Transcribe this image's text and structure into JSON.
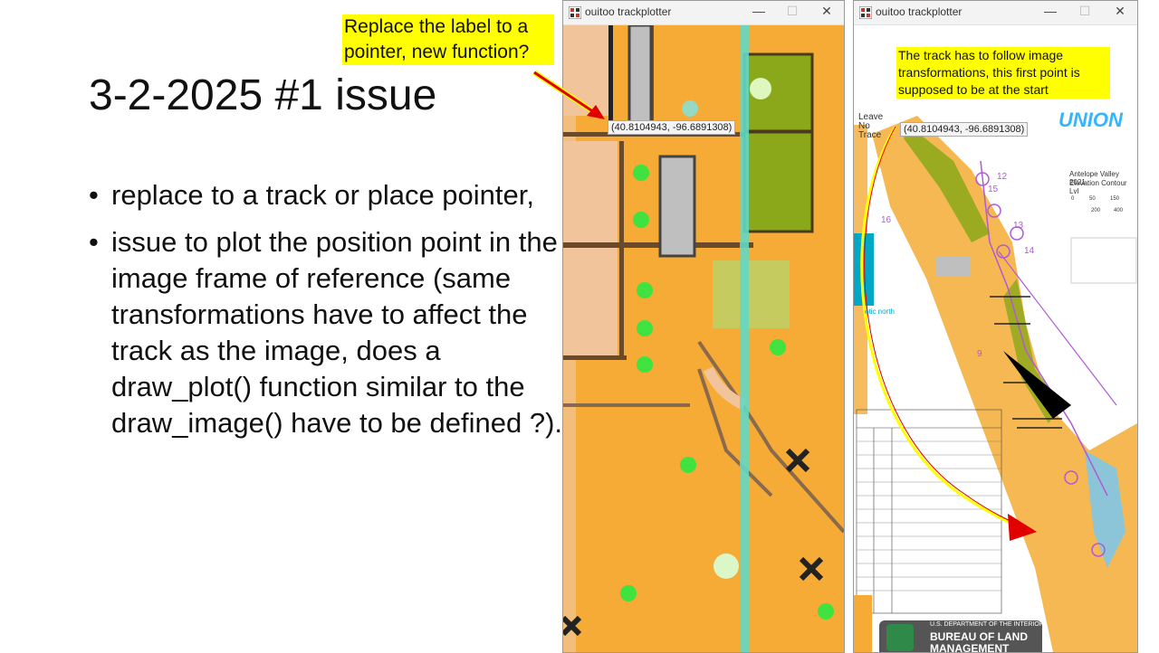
{
  "slide": {
    "title": "3-2-2025 #1 issue",
    "bullets": [
      "replace to a track or place pointer,",
      "issue to plot the position point in the image frame of reference (same transformations have to affect the track as the image, does a draw_plot() function similar to the draw_image() have to be defined ?)."
    ],
    "bullet_glyph": "•"
  },
  "callouts": {
    "left": "Replace the label to a pointer, new function?",
    "right": "The track has to follow image transformations, this first point is supposed to be at the start"
  },
  "windows": [
    {
      "title": "ouitoo trackplotter",
      "coord_label": "(40.8104943, -96.6891308)",
      "minimize_glyph": "—",
      "maximize_glyph": "☐",
      "close_glyph": "✕"
    },
    {
      "title": "ouitoo trackplotter",
      "coord_label": "(40.8104943, -96.6891308)",
      "minimize_glyph": "—",
      "maximize_glyph": "☐",
      "close_glyph": "✕",
      "map": {
        "header_text": "UNION",
        "leave_no_trace": [
          "Leave",
          "No",
          "Trace"
        ],
        "map_title": "Antelope Valley 2021",
        "map_subtitle": "Elevation Contour Lvl",
        "scale_ticks": [
          "0",
          "50",
          "150"
        ],
        "scale_ticks_2": [
          "200",
          "400"
        ],
        "north_label": "etic north",
        "control_numbers": [
          "16",
          "15",
          "13",
          "14",
          "12",
          "9"
        ],
        "agency_line1": "U.S. DEPARTMENT OF THE INTERIOR",
        "agency_line2": "BUREAU OF LAND",
        "agency_line3": "MANAGEMENT"
      }
    }
  ],
  "colors": {
    "callout_bg": "#ffff00",
    "arrow_red": "#e00000",
    "arrow_yellow": "#ffff00",
    "map_orange": "#f5ab35",
    "map_pink": "#f2c49b",
    "map_olive": "#8aa81a",
    "map_green": "#3fe23f",
    "map_cyan": "#64d7c3",
    "map_grey": "#bfbfbf"
  }
}
